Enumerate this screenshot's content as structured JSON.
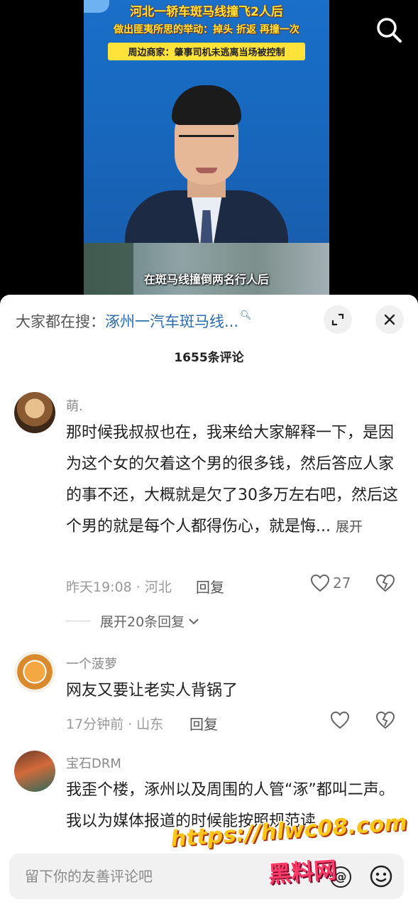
{
  "video": {
    "headline_line1": "河北一轿车斑马线撞飞2人后",
    "headline_line2": "做出匪夷所思的举动：掉头 折返 再撞一次",
    "headline_line3": "周边商家：肇事司机未逃离当场被控制",
    "subtitle": "在斑马线撞倒两名行人后",
    "search_icon": "search-icon"
  },
  "sheet": {
    "hot_search_label": "大家都在搜：",
    "hot_search_term": "涿州一汽车斑马线...",
    "hot_search_icon": "magnifier-icon",
    "comment_count": "1655条评论"
  },
  "comments": [
    {
      "nickname": "萌.",
      "text": "那时候我叔叔也在，我来给大家解释一下，是因为这个女的欠着这个男的很多钱，然后答应人家的事不还，大概就是欠了30多万左右吧，然后这个男的就是每个人都得伤心，就是悔...",
      "more_label": "展开",
      "meta": "昨天19:08 · 河北",
      "reply_label": "回复",
      "like_count": "27",
      "replies_toggle": "展开20条回复"
    },
    {
      "nickname": "一个菠萝",
      "text": "网友又要让老实人背锅了",
      "meta": "17分钟前 · 山东",
      "reply_label": "回复"
    },
    {
      "nickname": "宝石DRM",
      "text": "我歪个楼，涿州以及周围的人管“涿”都叫二声。我以为媒体报道的时候能按照规范读"
    }
  ],
  "input": {
    "placeholder": "留下你的友善评论吧",
    "at_icon": "@",
    "emoji_icon": "emoji-icon"
  },
  "watermark": {
    "url": "https://hlwc08.com",
    "brand": "黑料网"
  }
}
